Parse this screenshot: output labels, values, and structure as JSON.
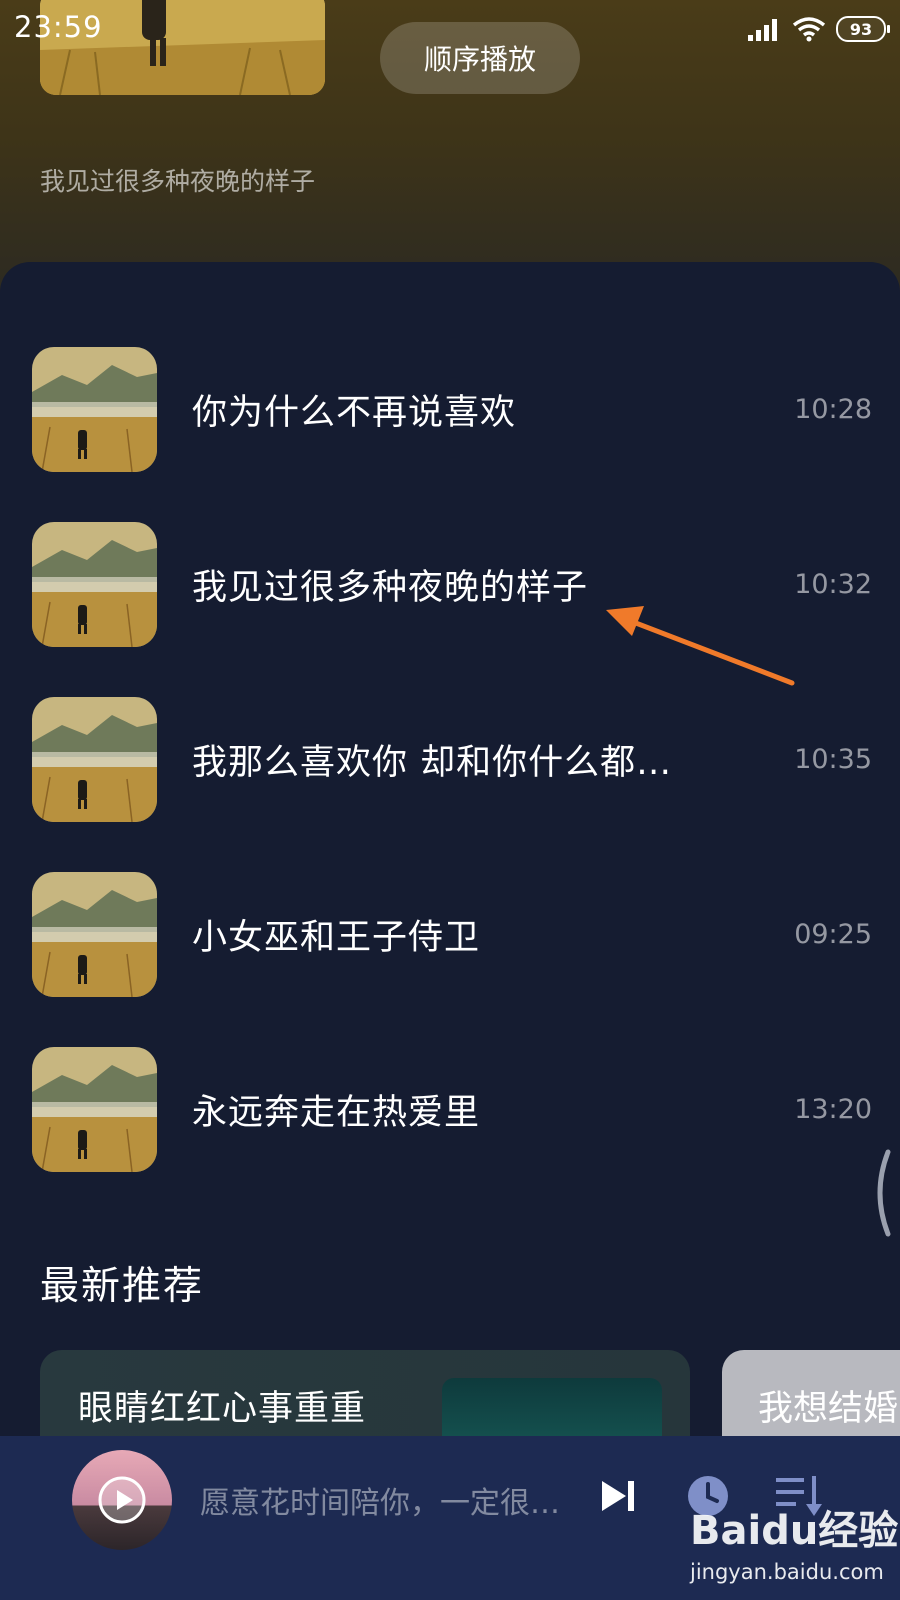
{
  "status_bar": {
    "time": "23:59",
    "battery": "93",
    "icons": [
      "signal-icon",
      "wifi-icon",
      "battery-icon"
    ]
  },
  "header": {
    "play_order_label": "顺序播放",
    "now_playing_title": "我见过很多种夜晚的样子"
  },
  "tracks": [
    {
      "title": "你为什么不再说喜欢",
      "duration": "10:28"
    },
    {
      "title": "我见过很多种夜晚的样子",
      "duration": "10:32"
    },
    {
      "title": "我那么喜欢你 却和你什么都…",
      "duration": "10:35"
    },
    {
      "title": "小女巫和王子侍卫",
      "duration": "09:25"
    },
    {
      "title": "永远奔走在热爱里",
      "duration": "13:20"
    }
  ],
  "recommend": {
    "section_title": "最新推荐",
    "cards": [
      {
        "title": "眼睛红红心事重重"
      },
      {
        "title": "我想结婚"
      }
    ]
  },
  "mini_player": {
    "lyric": "愿意花时间陪你，一定很…",
    "icons": [
      "play-icon",
      "skip-next-icon",
      "timer-icon",
      "queue-icon"
    ]
  },
  "watermark": {
    "logo": "Baidu经验",
    "url": "jingyan.baidu.com"
  },
  "colors": {
    "panel_bg": "#151c31",
    "mini_player_bg": "#1d2a52",
    "annotation_arrow": "#f07a2a"
  }
}
